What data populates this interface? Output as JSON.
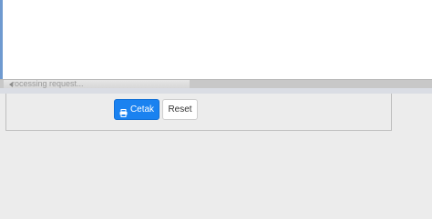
{
  "status": {
    "text": "rocessing request..."
  },
  "actions": {
    "print_label": "Cetak",
    "print_icon": "printer-icon",
    "reset_label": "Reset"
  },
  "colors": {
    "primary": "#1a82f0",
    "background": "#ececec"
  }
}
